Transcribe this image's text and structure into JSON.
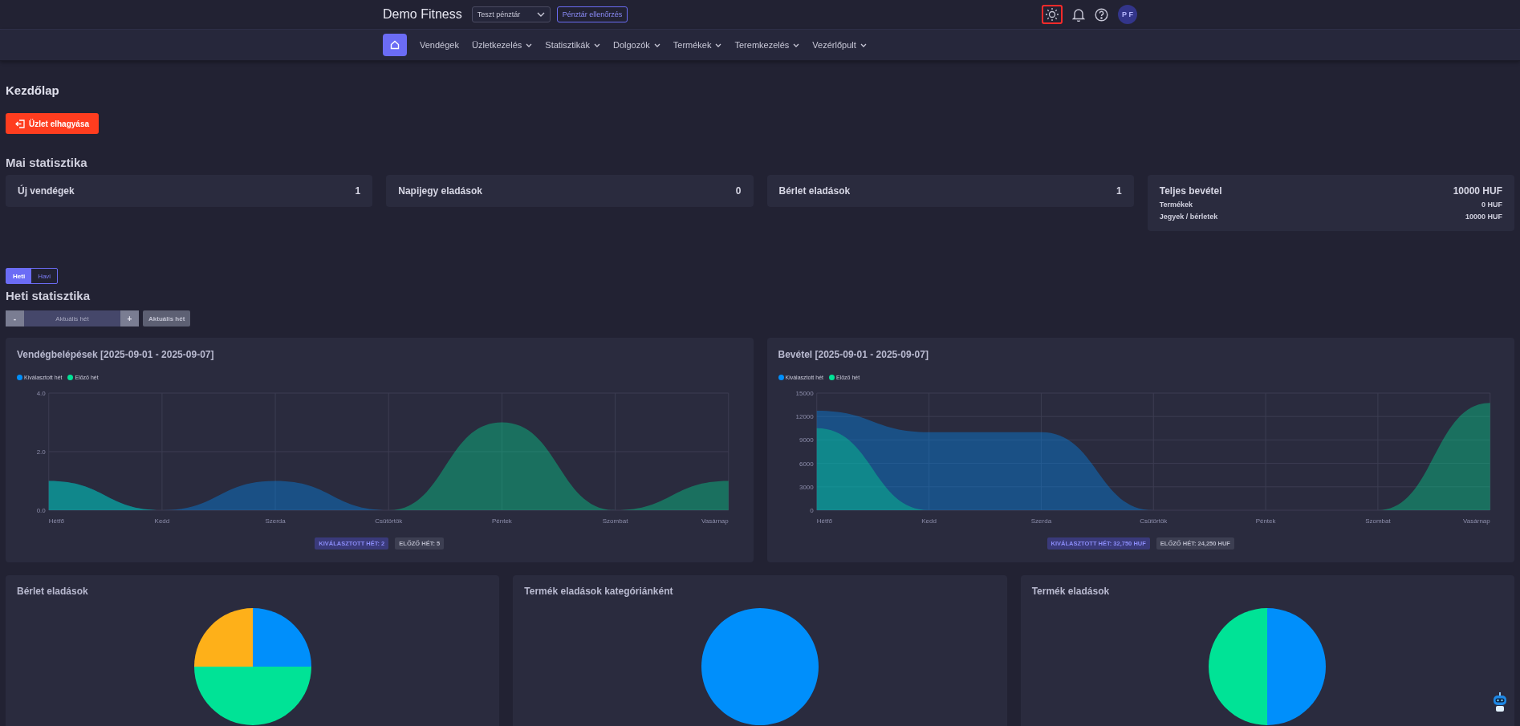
{
  "header": {
    "brand": "Demo Fitness",
    "register_select": {
      "value": "Teszt pénztár"
    },
    "check_button": "Pénztár ellenőrzés",
    "theme_button": {
      "highlighted": true
    },
    "avatar": "P F"
  },
  "nav": [
    {
      "label": "Vendégek",
      "dropdown": false
    },
    {
      "label": "Üzletkezelés",
      "dropdown": true
    },
    {
      "label": "Statisztikák",
      "dropdown": true
    },
    {
      "label": "Dolgozók",
      "dropdown": true
    },
    {
      "label": "Termékek",
      "dropdown": true
    },
    {
      "label": "Teremkezelés",
      "dropdown": true
    },
    {
      "label": "Vezérlőpult",
      "dropdown": true
    }
  ],
  "page_title": "Kezdőlap",
  "leave_button": "Üzlet elhagyása",
  "today": {
    "title": "Mai statisztika",
    "cards": [
      {
        "label": "Új vendégek",
        "value": "1"
      },
      {
        "label": "Napijegy eladások",
        "value": "0"
      },
      {
        "label": "Bérlet eladások",
        "value": "1"
      },
      {
        "label": "Teljes bevétel",
        "value": "10000 HUF",
        "details": [
          {
            "label": "Termékek",
            "value": "0 HUF"
          },
          {
            "label": "Jegyek / bérletek",
            "value": "10000 HUF"
          }
        ]
      }
    ]
  },
  "period_tabs": [
    {
      "label": "Heti",
      "selected": true
    },
    {
      "label": "Havi",
      "selected": false
    }
  ],
  "weekly": {
    "title": "Heti statisztika",
    "stepper": {
      "minus": "-",
      "placeholder": "Aktuális hét",
      "plus": "+"
    },
    "current_button": "Aktuális hét",
    "charts": [
      {
        "title": "Vendégbelépések [2025-09-01 - 2025-09-07]",
        "chart_data": {
          "type": "area",
          "categories": [
            "Hétfő",
            "Kedd",
            "Szerda",
            "Csütörtök",
            "Péntek",
            "Szombat",
            "Vasárnap"
          ],
          "series": [
            {
              "name": "Kiválasztott hét",
              "color": "#008ffb",
              "values": [
                1,
                0,
                1,
                0,
                0,
                0,
                0
              ]
            },
            {
              "name": "Előző hét",
              "color": "#00e396",
              "values": [
                1,
                0,
                0,
                0,
                3,
                0,
                1
              ]
            }
          ],
          "grid": true,
          "ylim": [
            0,
            4
          ],
          "yticks": [
            {
              "value": 0,
              "label": "0.0"
            },
            {
              "value": 2,
              "label": "2.0"
            },
            {
              "value": 4,
              "label": "4.0"
            }
          ]
        },
        "badges": [
          {
            "text": "KIVÁLASZTOTT HÉT: 2",
            "kind": "selected"
          },
          {
            "text": "ELŐZŐ HÉT: 5",
            "kind": "previous"
          }
        ]
      },
      {
        "title": "Bevétel [2025-09-01 - 2025-09-07]",
        "chart_data": {
          "type": "area",
          "categories": [
            "Hétfő",
            "Kedd",
            "Szerda",
            "Csütörtök",
            "Péntek",
            "Szombat",
            "Vasárnap"
          ],
          "series": [
            {
              "name": "Kiválasztott hét",
              "color": "#008ffb",
              "values": [
                12750,
                10000,
                10000,
                0,
                0,
                0,
                0
              ]
            },
            {
              "name": "Előző hét",
              "color": "#00e396",
              "values": [
                10500,
                0,
                0,
                0,
                0,
                0,
                13750
              ]
            }
          ],
          "grid": true,
          "ylim": [
            0,
            15000
          ],
          "yticks": [
            0,
            3000,
            6000,
            9000,
            12000,
            15000
          ]
        },
        "badges": [
          {
            "text": "KIVÁLASZTOTT HÉT: 32,750 HUF",
            "kind": "selected"
          },
          {
            "text": "ELŐZŐ HÉT: 24,250 HUF",
            "kind": "previous"
          }
        ]
      }
    ]
  },
  "pies": [
    {
      "title": "Bérlet eladások",
      "kind": "picture"
    },
    {
      "title": "Termék eladások kategóriánként",
      "kind": "picture"
    },
    {
      "title": "Termék eladások",
      "kind": "picture"
    }
  ]
}
